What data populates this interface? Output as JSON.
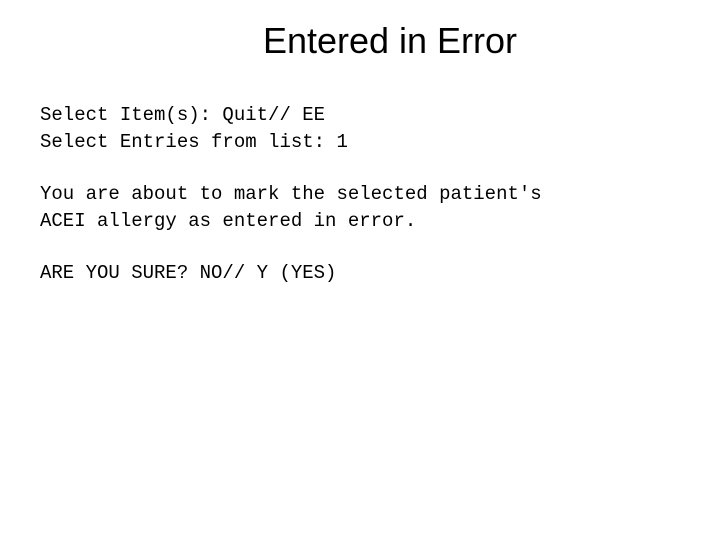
{
  "title": "Entered in Error",
  "lines": {
    "select_items": "Select Item(s): Quit// EE",
    "select_entries": "Select Entries from list: 1",
    "confirm_1": "You are about to mark the selected patient's",
    "confirm_2": "ACEI allergy as entered in error.",
    "sure": "ARE YOU SURE? NO// Y  (YES)"
  }
}
